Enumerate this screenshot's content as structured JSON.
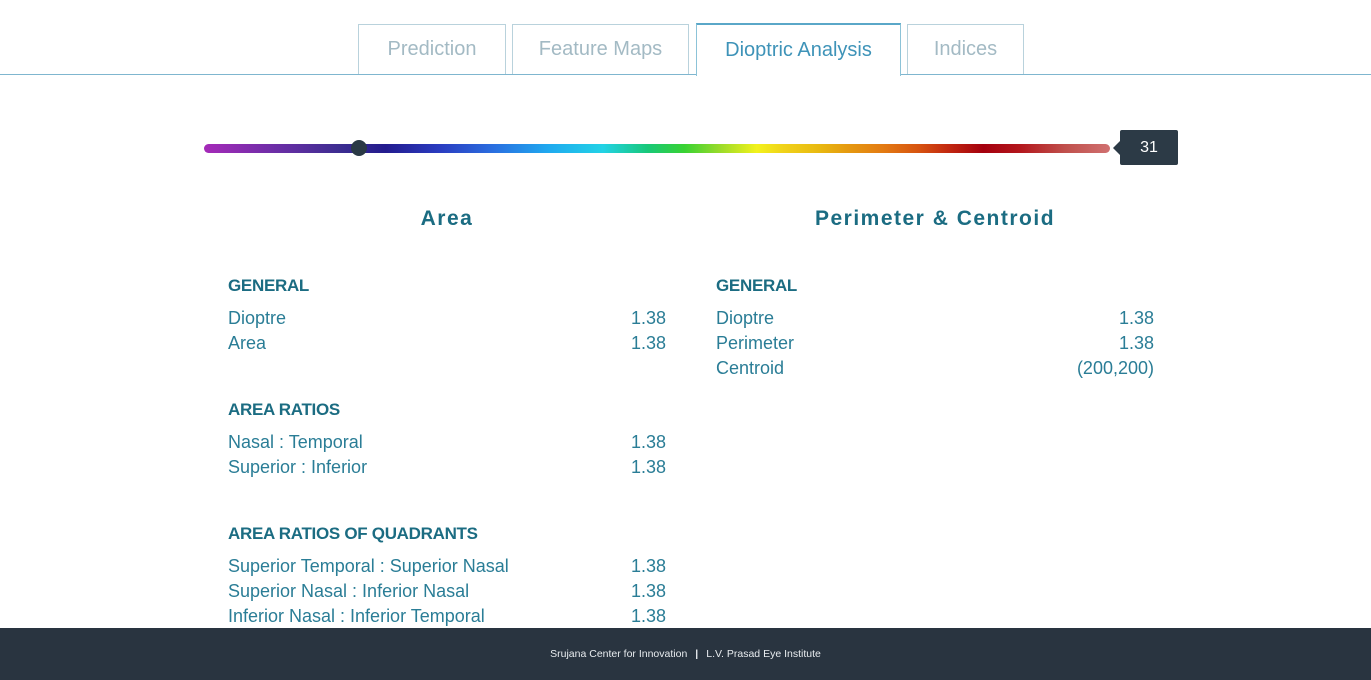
{
  "tabs": [
    {
      "label": "Prediction",
      "active": false
    },
    {
      "label": "Feature Maps",
      "active": false
    },
    {
      "label": "Dioptric Analysis",
      "active": true
    },
    {
      "label": "Indices",
      "active": false
    }
  ],
  "slider": {
    "value": "31"
  },
  "area": {
    "title": "Area",
    "general": {
      "heading": "GENERAL",
      "rows": [
        {
          "label": "Dioptre",
          "value": "1.38"
        },
        {
          "label": "Area",
          "value": "1.38"
        }
      ]
    },
    "area_ratios": {
      "heading": "AREA RATIOS",
      "rows": [
        {
          "label": "Nasal : Temporal",
          "value": "1.38"
        },
        {
          "label": "Superior : Inferior",
          "value": "1.38"
        }
      ]
    },
    "quadrant_ratios": {
      "heading": "AREA RATIOS OF QUADRANTS",
      "rows": [
        {
          "label": "Superior Temporal : Superior Nasal",
          "value": "1.38"
        },
        {
          "label": "Superior Nasal : Inferior Nasal",
          "value": "1.38"
        },
        {
          "label": "Inferior Nasal : Inferior Temporal",
          "value": "1.38"
        }
      ]
    }
  },
  "perimeter": {
    "title": "Perimeter & Centroid",
    "general": {
      "heading": "GENERAL",
      "rows": [
        {
          "label": "Dioptre",
          "value": "1.38"
        },
        {
          "label": "Perimeter",
          "value": "1.38"
        },
        {
          "label": "Centroid",
          "value": "(200,200)"
        }
      ]
    }
  },
  "footer": {
    "left": "Srujana Center for Innovation",
    "separator": "|",
    "right": "L.V. Prasad Eye Institute"
  }
}
